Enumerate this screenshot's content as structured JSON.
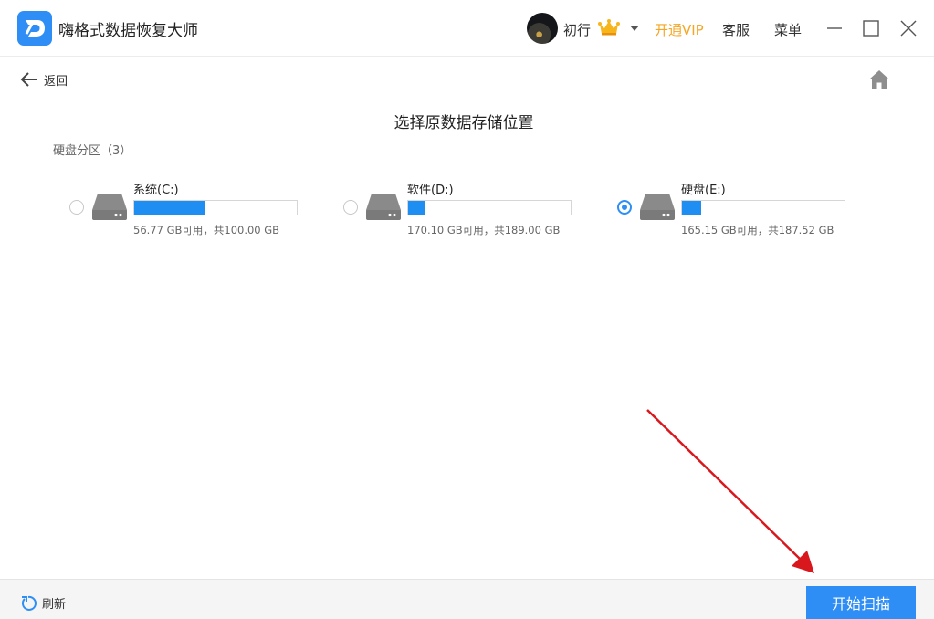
{
  "app": {
    "title": "嗨格式数据恢复大师",
    "logo_icon": "app-logo-icon"
  },
  "header": {
    "username": "初行",
    "vip_label": "开通VIP",
    "service_label": "客服",
    "menu_label": "菜单",
    "colors": {
      "vip": "#f5a623",
      "accent": "#2f8ef5"
    }
  },
  "nav": {
    "back_label": "返回"
  },
  "page": {
    "title": "选择原数据存储位置",
    "section_label": "硬盘分区（3）"
  },
  "drives": [
    {
      "name": "系统(C:)",
      "info": "56.77 GB可用，共100.00 GB",
      "used_fraction": 0.4323,
      "selected": false
    },
    {
      "name": "软件(D:)",
      "info": "170.10 GB可用，共189.00 GB",
      "used_fraction": 0.1,
      "selected": false
    },
    {
      "name": "硬盘(E:)",
      "info": "165.15 GB可用，共187.52 GB",
      "used_fraction": 0.1193,
      "selected": true
    }
  ],
  "footer": {
    "refresh_label": "刷新",
    "scan_label": "开始扫描"
  }
}
